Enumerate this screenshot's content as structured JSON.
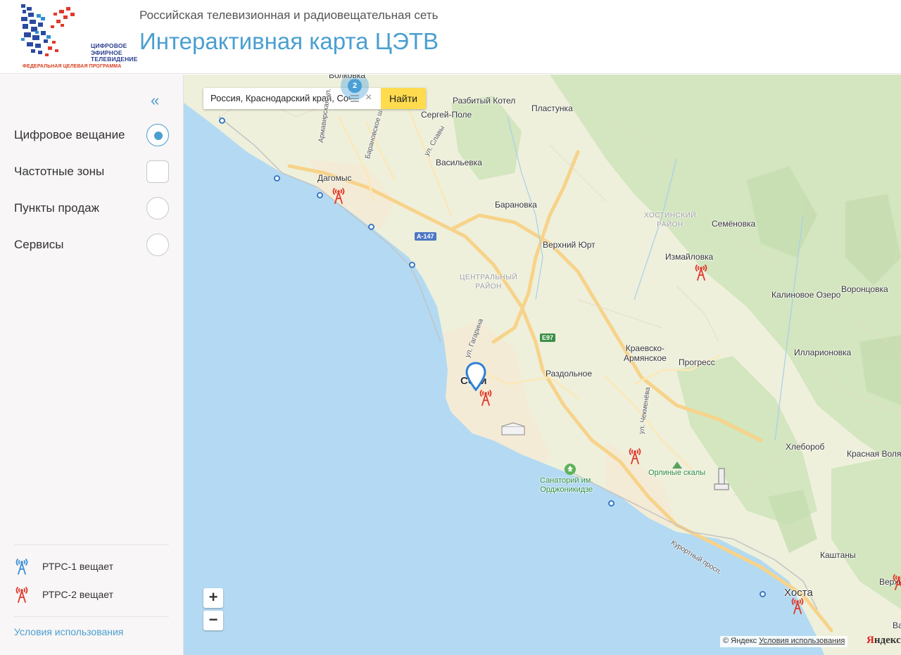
{
  "header": {
    "logo_text": [
      "ЦИФРОВОЕ",
      "ЭФИРНОЕ",
      "ТЕЛЕВИДЕНИЕ"
    ],
    "logo_sub": "ФЕДЕРАЛЬНАЯ ЦЕЛЕВАЯ ПРОГРАММА",
    "subtitle": "Российская телевизионная и радиовещательная сеть",
    "title": "Интерактивная карта ЦЭТВ"
  },
  "sidebar": {
    "collapse_icon": "double-chevron-left-icon",
    "items": [
      {
        "label": "Цифровое вещание",
        "control": "radio",
        "selected": true
      },
      {
        "label": "Частотные зоны",
        "control": "checkbox",
        "selected": false
      },
      {
        "label": "Пункты продаж",
        "control": "radio",
        "selected": false
      },
      {
        "label": "Сервисы",
        "control": "radio",
        "selected": false
      }
    ],
    "legend": [
      {
        "label": "РТРС-1 вещает",
        "color": "#3a8fd6"
      },
      {
        "label": "РТРС-2 вещает",
        "color": "#e0392b"
      }
    ],
    "terms_link": "Условия использования"
  },
  "map": {
    "search": {
      "value": "Россия, Краснодарский край, Сочи",
      "button": "Найти"
    },
    "cluster_count": "2",
    "places": {
      "volkovka": "Волковка",
      "razbity": "Разбитый Котел",
      "plastunka": "Пластунка",
      "sergey": "Сергей-Поле",
      "vasilevka": "Васильевка",
      "dagomys": "Дагомыс",
      "baranovka": "Барановка",
      "verkhny": "Верхний Юрт",
      "semenovka": "Семёновка",
      "izmailovka": "Измайловка",
      "kalinovoe": "Калиновое Озеро",
      "vorontsovka": "Воронцовка",
      "krayevsko": "Краевско-\nАрмянское",
      "progress": "Прогресс",
      "illarionovka": "Илларионовка",
      "razdolnoe": "Раздольное",
      "sochi": "Сочи",
      "khleborob": "Хлебороб",
      "krasnaya": "Красная Воля",
      "orlinye": "Орлиные скалы",
      "sanatoriy": "Санаторий им.\nОрджоникидзе",
      "kashtany": "Каштаны",
      "khosta": "Хоста",
      "verkhn": "Верхн",
      "va": "Ва"
    },
    "districts": {
      "khostinsky": "ХОСТИНСКИЙ\nРАЙОН",
      "central": "ЦЕНТРАЛЬНЫЙ\nРАЙОН"
    },
    "streets": {
      "armavirskaya": "Армавирская ул.",
      "baranovskoe": "Барановское ш.",
      "slavy": "ул. Славы",
      "gagarina": "ул. Гагарина",
      "chekmeneva": "ул. Чекменёва",
      "kurortny": "Курортный просп."
    },
    "shields": {
      "a147": "А-147",
      "e97": "Е97"
    },
    "zoom_in": "+",
    "zoom_out": "−",
    "attribution_prefix": "© Яндекс",
    "attribution_link": "Условия использования",
    "yandex_logo_first": "Я",
    "yandex_logo_rest": "ндекс"
  }
}
